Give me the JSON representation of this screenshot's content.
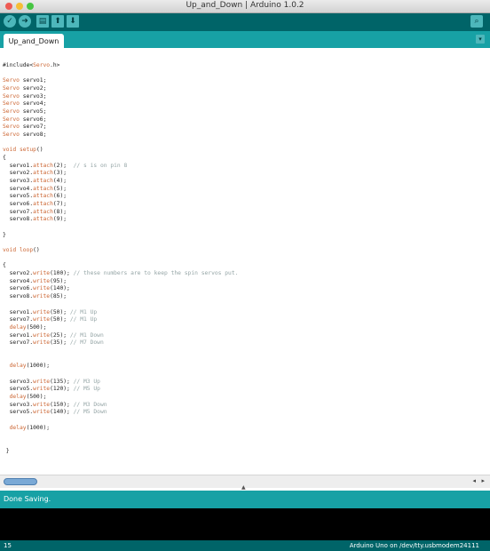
{
  "window": {
    "title": "Up_and_Down | Arduino 1.0.2"
  },
  "toolbar": {
    "buttons": [
      {
        "name": "verify",
        "icon": "check-icon",
        "glyph": "✓"
      },
      {
        "name": "upload",
        "icon": "arrow-right-icon",
        "glyph": "➜"
      },
      {
        "name": "new",
        "icon": "new-file-icon",
        "glyph": "▤"
      },
      {
        "name": "open",
        "icon": "open-arrow-up-icon",
        "glyph": "⬆"
      },
      {
        "name": "save",
        "icon": "save-arrow-down-icon",
        "glyph": "⬇"
      }
    ],
    "serial_glyph": "⌕"
  },
  "tabs": [
    {
      "label": "Up_and_Down"
    }
  ],
  "tab_menu_glyph": "▾",
  "code_lines": [
    [
      {
        "t": "#include<"
      },
      {
        "t": "Servo",
        "k": "kw"
      },
      {
        "t": ".h>"
      }
    ],
    [],
    [
      {
        "t": "Servo",
        "k": "kw"
      },
      {
        "t": " servo1;"
      }
    ],
    [
      {
        "t": "Servo",
        "k": "kw"
      },
      {
        "t": " servo2;"
      }
    ],
    [
      {
        "t": "Servo",
        "k": "kw"
      },
      {
        "t": " servo3;"
      }
    ],
    [
      {
        "t": "Servo",
        "k": "kw"
      },
      {
        "t": " servo4;"
      }
    ],
    [
      {
        "t": "Servo",
        "k": "kw"
      },
      {
        "t": " servo5;"
      }
    ],
    [
      {
        "t": "Servo",
        "k": "kw"
      },
      {
        "t": " servo6;"
      }
    ],
    [
      {
        "t": "Servo",
        "k": "kw"
      },
      {
        "t": " servo7;"
      }
    ],
    [
      {
        "t": "Servo",
        "k": "kw"
      },
      {
        "t": " servo8;"
      }
    ],
    [],
    [
      {
        "t": "void",
        "k": "kw"
      },
      {
        "t": " "
      },
      {
        "t": "setup",
        "k": "fn"
      },
      {
        "t": "()"
      }
    ],
    [
      {
        "t": "{"
      }
    ],
    [
      {
        "t": "  servo1."
      },
      {
        "t": "attach",
        "k": "fn"
      },
      {
        "t": "(2);  "
      },
      {
        "t": "// s is on pin 8",
        "k": "cm"
      }
    ],
    [
      {
        "t": "  servo2."
      },
      {
        "t": "attach",
        "k": "fn"
      },
      {
        "t": "(3);"
      }
    ],
    [
      {
        "t": "  servo3."
      },
      {
        "t": "attach",
        "k": "fn"
      },
      {
        "t": "(4);"
      }
    ],
    [
      {
        "t": "  servo4."
      },
      {
        "t": "attach",
        "k": "fn"
      },
      {
        "t": "(5);"
      }
    ],
    [
      {
        "t": "  servo5."
      },
      {
        "t": "attach",
        "k": "fn"
      },
      {
        "t": "(6);"
      }
    ],
    [
      {
        "t": "  servo6."
      },
      {
        "t": "attach",
        "k": "fn"
      },
      {
        "t": "(7);"
      }
    ],
    [
      {
        "t": "  servo7."
      },
      {
        "t": "attach",
        "k": "fn"
      },
      {
        "t": "(8);"
      }
    ],
    [
      {
        "t": "  servo8."
      },
      {
        "t": "attach",
        "k": "fn"
      },
      {
        "t": "(9);"
      }
    ],
    [],
    [
      {
        "t": "}"
      }
    ],
    [],
    [
      {
        "t": "void",
        "k": "kw"
      },
      {
        "t": " "
      },
      {
        "t": "loop",
        "k": "fn"
      },
      {
        "t": "()"
      }
    ],
    [],
    [
      {
        "t": "{"
      }
    ],
    [
      {
        "t": "  servo2."
      },
      {
        "t": "write",
        "k": "fn"
      },
      {
        "t": "(100); "
      },
      {
        "t": "// these numbers are to keep the spin servos put.",
        "k": "cm"
      }
    ],
    [
      {
        "t": "  servo4."
      },
      {
        "t": "write",
        "k": "fn"
      },
      {
        "t": "(95);"
      }
    ],
    [
      {
        "t": "  servo6."
      },
      {
        "t": "write",
        "k": "fn"
      },
      {
        "t": "(140);"
      }
    ],
    [
      {
        "t": "  servo8."
      },
      {
        "t": "write",
        "k": "fn"
      },
      {
        "t": "(85);"
      }
    ],
    [],
    [
      {
        "t": "  servo1."
      },
      {
        "t": "write",
        "k": "fn"
      },
      {
        "t": "(50); "
      },
      {
        "t": "// M1 Up",
        "k": "cm"
      }
    ],
    [
      {
        "t": "  servo7."
      },
      {
        "t": "write",
        "k": "fn"
      },
      {
        "t": "(50); "
      },
      {
        "t": "// M1 Up",
        "k": "cm"
      }
    ],
    [
      {
        "t": "  "
      },
      {
        "t": "delay",
        "k": "fn"
      },
      {
        "t": "(500);"
      }
    ],
    [
      {
        "t": "  servo1."
      },
      {
        "t": "write",
        "k": "fn"
      },
      {
        "t": "(25); "
      },
      {
        "t": "// M1 Down",
        "k": "cm"
      }
    ],
    [
      {
        "t": "  servo7."
      },
      {
        "t": "write",
        "k": "fn"
      },
      {
        "t": "(35); "
      },
      {
        "t": "// M7 Down",
        "k": "cm"
      }
    ],
    [],
    [],
    [
      {
        "t": "  "
      },
      {
        "t": "delay",
        "k": "fn"
      },
      {
        "t": "(1000);"
      }
    ],
    [],
    [
      {
        "t": "  servo3."
      },
      {
        "t": "write",
        "k": "fn"
      },
      {
        "t": "(135); "
      },
      {
        "t": "// M3 Up",
        "k": "cm"
      }
    ],
    [
      {
        "t": "  servo5."
      },
      {
        "t": "write",
        "k": "fn"
      },
      {
        "t": "(120); "
      },
      {
        "t": "// M5 Up",
        "k": "cm"
      }
    ],
    [
      {
        "t": "  "
      },
      {
        "t": "delay",
        "k": "fn"
      },
      {
        "t": "(500);"
      }
    ],
    [
      {
        "t": "  servo3."
      },
      {
        "t": "write",
        "k": "fn"
      },
      {
        "t": "(150); "
      },
      {
        "t": "// M3 Down",
        "k": "cm"
      }
    ],
    [
      {
        "t": "  servo5."
      },
      {
        "t": "write",
        "k": "fn"
      },
      {
        "t": "(140); "
      },
      {
        "t": "// M5 Down",
        "k": "cm"
      }
    ],
    [],
    [
      {
        "t": "  "
      },
      {
        "t": "delay",
        "k": "fn"
      },
      {
        "t": "(1000);"
      }
    ],
    [],
    [],
    [
      {
        "t": " }"
      }
    ]
  ],
  "scroll": {
    "left_glyph": "◂",
    "right_glyph": "▸",
    "grip_glyph": "▲"
  },
  "status": {
    "message": "Done Saving."
  },
  "footer": {
    "line_number": "15",
    "board": "Arduino Uno on /dev/tty.usbmodem24111"
  },
  "colors": {
    "accent": "#006468",
    "tab_bar": "#17a1a5",
    "keyword": "#cc6633",
    "comment": "#95a5a6"
  }
}
